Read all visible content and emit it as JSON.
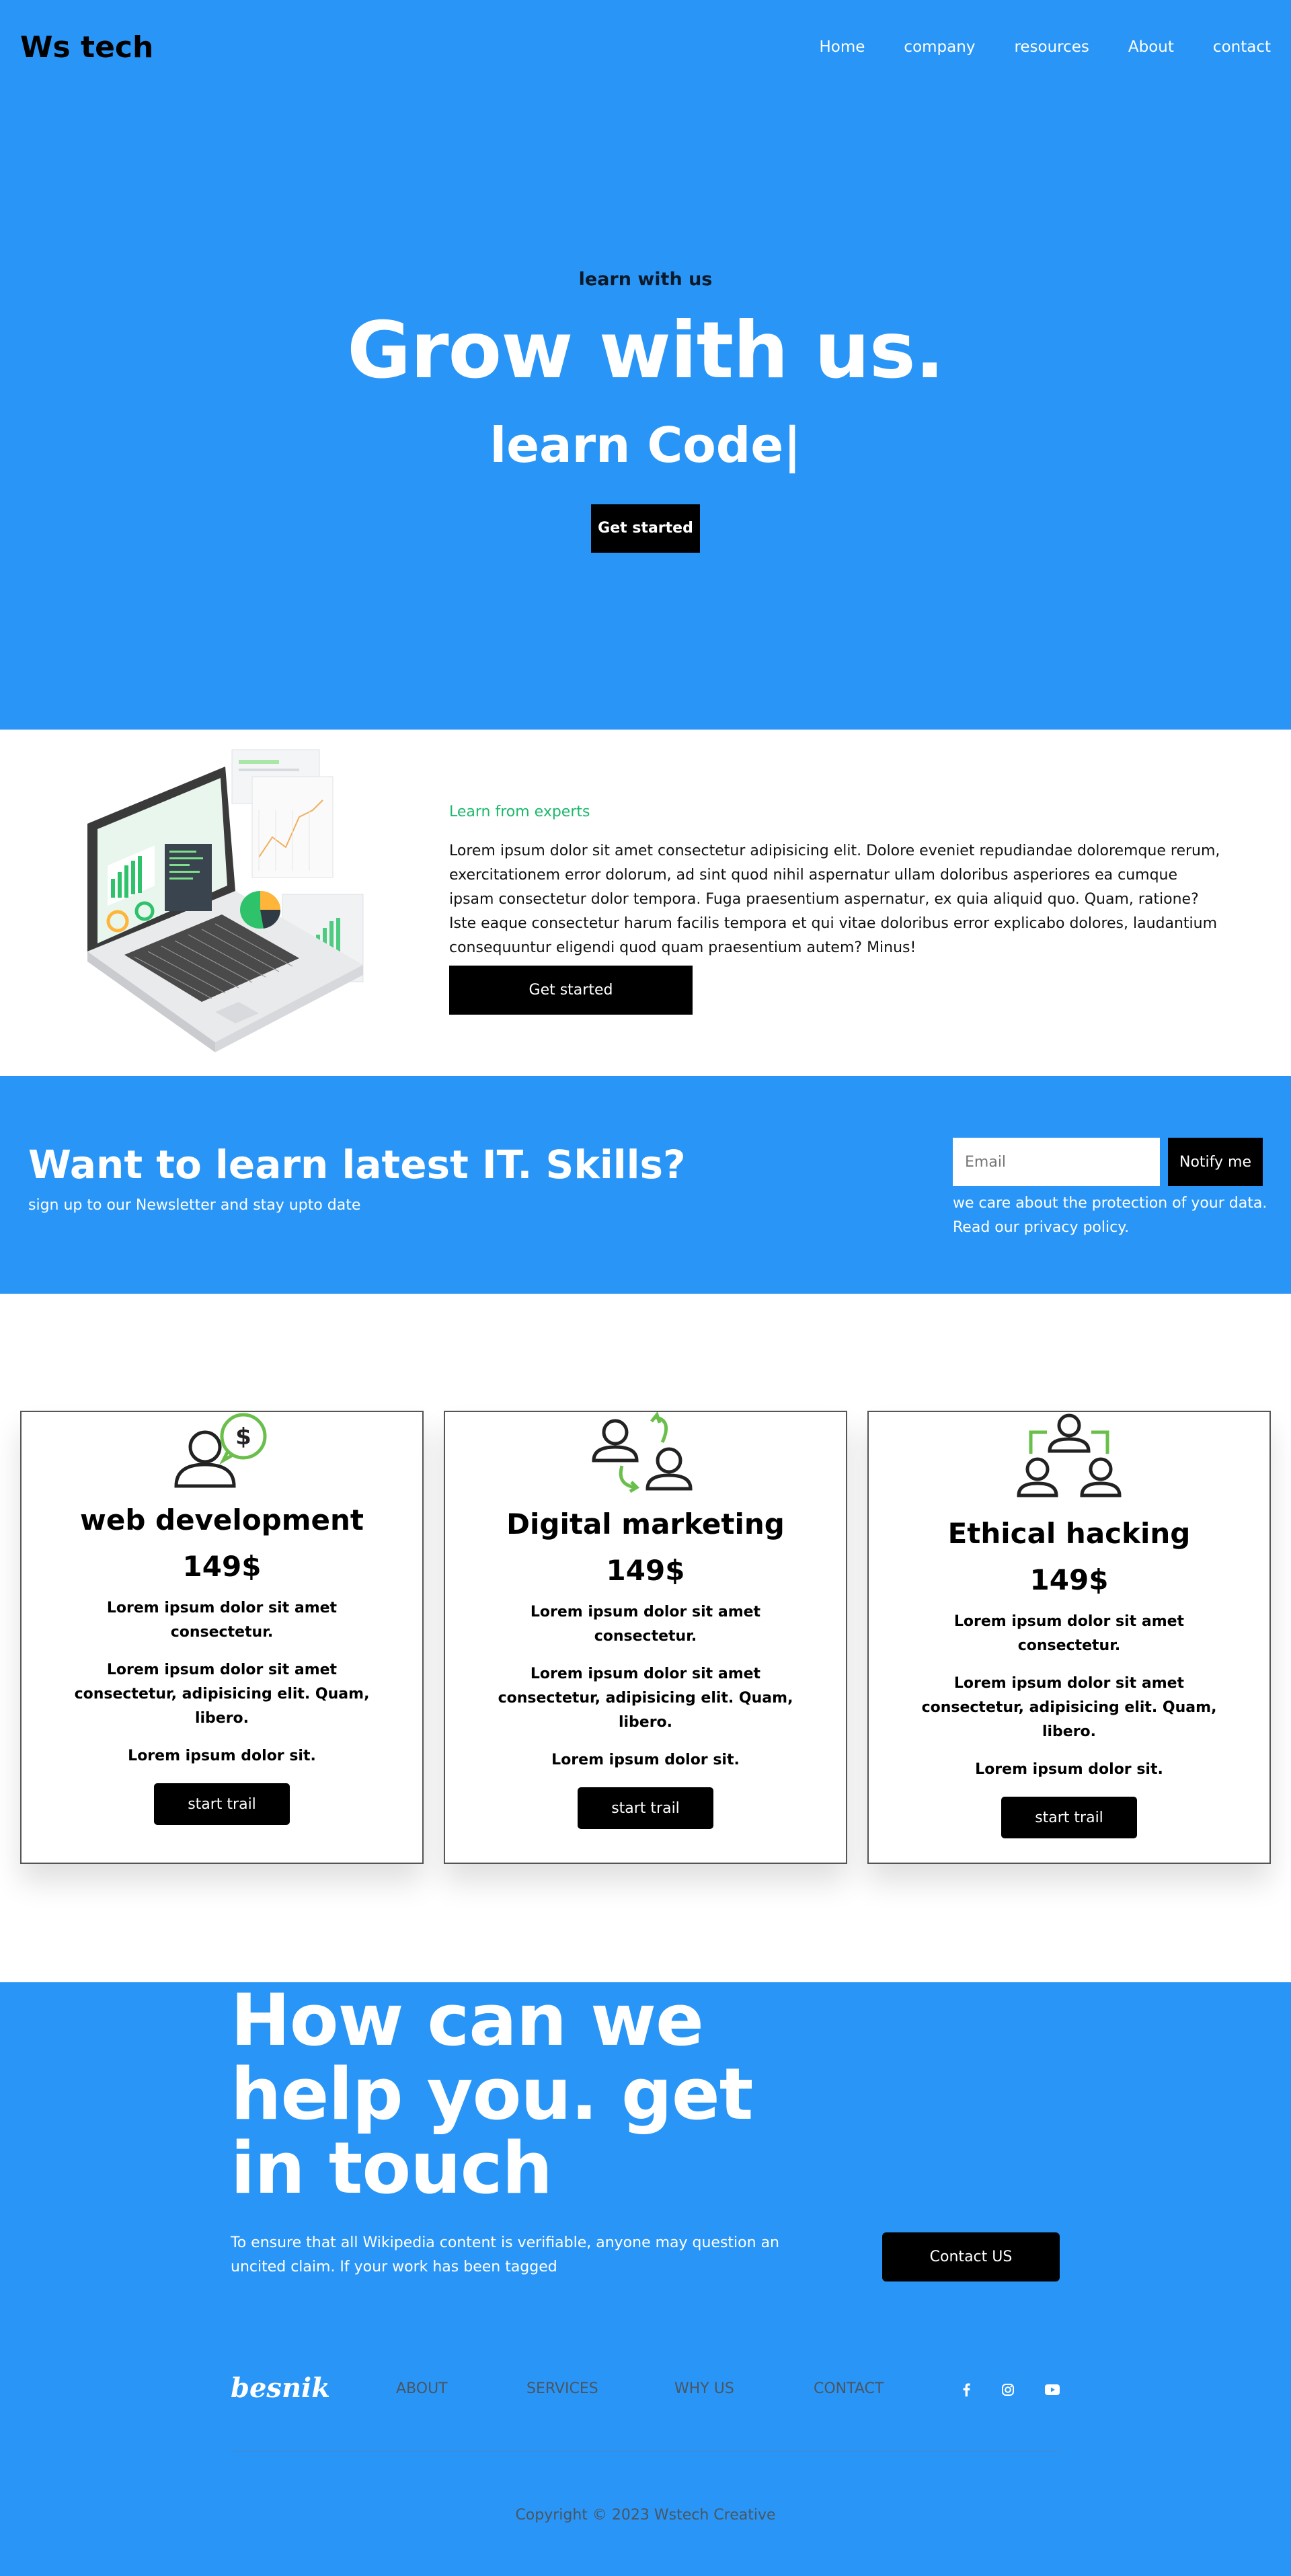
{
  "colors": {
    "primary_blue": "#2996f7",
    "black": "#000000",
    "accent_green": "#1bb86b"
  },
  "header": {
    "logo": "Ws tech",
    "nav": [
      "Home",
      "company",
      "resources",
      "About",
      "contact"
    ]
  },
  "hero": {
    "eyebrow": "learn with us",
    "title": "Grow with us.",
    "subtitle": "learn Code|",
    "cta_label": "Get started"
  },
  "about": {
    "illustration": "laptop-dashboard-illustration",
    "eyebrow": "Learn from experts",
    "body": "Lorem ipsum dolor sit amet consectetur adipisicing elit. Dolore eveniet repudiandae doloremque rerum, exercitationem error dolorum, ad sint quod nihil aspernatur ullam doloribus asperiores ea cumque ipsam consectetur dolor tempora. Fuga praesentium aspernatur, ex quia aliquid quo. Quam, ratione? Iste eaque consectetur harum facilis tempora et qui vitae doloribus error explicabo dolores, laudantium consequuntur eligendi quod quam praesentium autem? Minus!",
    "cta_label": "Get started"
  },
  "newsletter": {
    "title": "Want to learn latest IT. Skills?",
    "subtitle": "sign up to our Newsletter and stay upto date",
    "email_placeholder": "Email",
    "button_label": "Notify me",
    "note_prefix": "we care about the protection of your data. Read our ",
    "note_link": "privacy policy."
  },
  "courses": {
    "cards": [
      {
        "icon": "user-dollar-icon",
        "title": "web development",
        "price": "149$",
        "line1": "Lorem ipsum dolor sit amet consectetur.",
        "line2": "Lorem ipsum dolor sit amet consectetur, adipisicing elit. Quam, libero.",
        "line3": "Lorem ipsum dolor sit.",
        "button": "start trail"
      },
      {
        "icon": "users-exchange-icon",
        "title": "Digital marketing",
        "price": "149$",
        "line1": "Lorem ipsum dolor sit amet consectetur.",
        "line2": "Lorem ipsum dolor sit amet consectetur, adipisicing elit. Quam, libero.",
        "line3": "Lorem ipsum dolor sit.",
        "button": "start trail"
      },
      {
        "icon": "team-network-icon",
        "title": "Ethical hacking",
        "price": "149$",
        "line1": "Lorem ipsum dolor sit amet consectetur.",
        "line2": "Lorem ipsum dolor sit amet consectetur, adipisicing elit. Quam, libero.",
        "line3": "Lorem ipsum dolor sit.",
        "button": "start trail"
      }
    ]
  },
  "contact": {
    "title": "How can we help you. get in touch",
    "text": "To ensure that all Wikipedia content is verifiable, anyone may question an uncited claim. If your work has been tagged",
    "button_label": "Contact US"
  },
  "footer": {
    "logo": "besnik",
    "links": [
      "ABOUT",
      "SERVICES",
      "WHY US",
      "CONTACT"
    ],
    "social": [
      "facebook-icon",
      "instagram-icon",
      "youtube-icon"
    ],
    "copyright": "Copyright © 2023 Wstech Creative"
  }
}
